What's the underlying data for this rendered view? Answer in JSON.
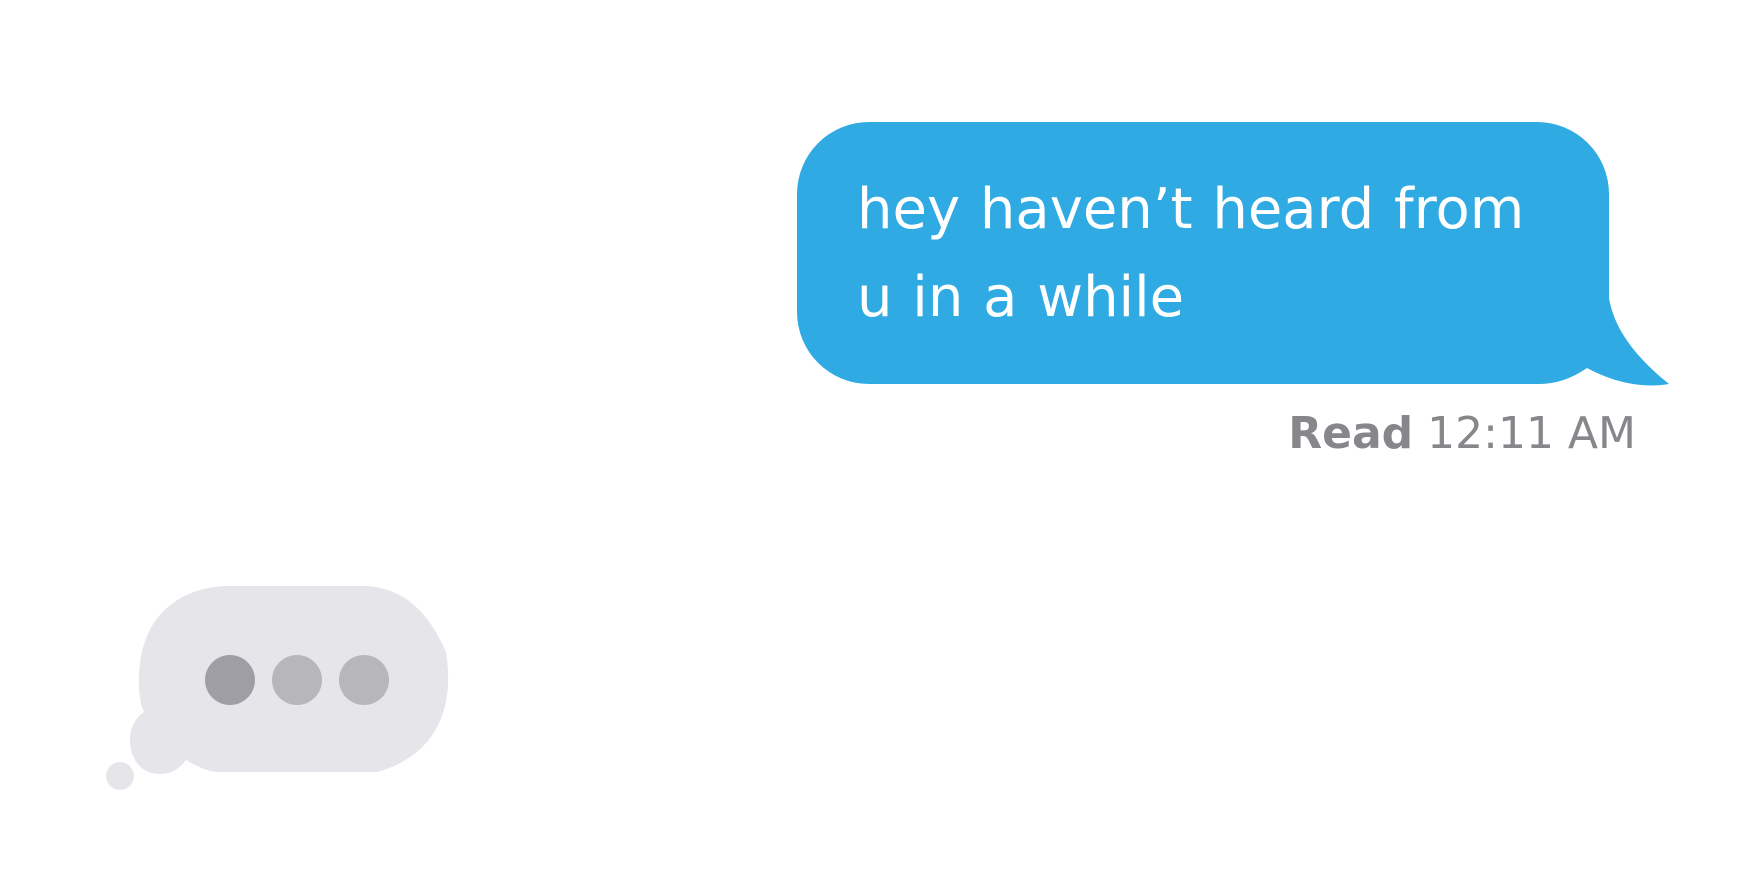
{
  "message": {
    "lines": [
      "hey haven’t heard from",
      "u in a while"
    ],
    "bubble_color": "#30aae3",
    "text_color": "#ffffff"
  },
  "receipt": {
    "label": "Read",
    "time": "12:11 AM",
    "color": "#86868b"
  },
  "typing_indicator": {
    "bubble_color": "#e5e5ea",
    "dot_colors": [
      "#9f9ea4",
      "#b7b6bb",
      "#b7b6bb"
    ]
  }
}
